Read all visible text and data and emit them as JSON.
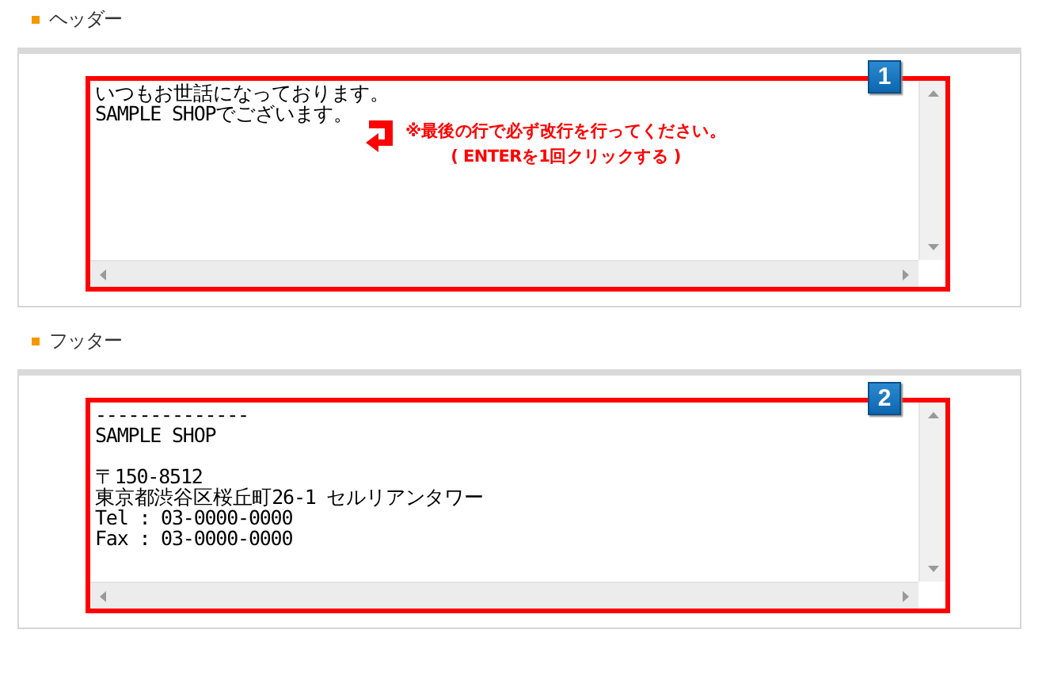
{
  "sections": [
    {
      "heading": "ヘッダー",
      "badge": "1",
      "text": "いつもお世話になっております。\nSAMPLE SHOPでございます。",
      "note": {
        "lines": [
          "※最後の行で必ず改行を行ってください。",
          "( ENTERを1回クリックする )"
        ]
      }
    },
    {
      "heading": "フッター",
      "badge": "2",
      "text": "--------------\nSAMPLE SHOP\n\n〒150-8512\n東京都渋谷区桜丘町26-1 セルリアンタワー\nTel : 03-0000-0000\nFax : 03-0000-0000"
    }
  ]
}
